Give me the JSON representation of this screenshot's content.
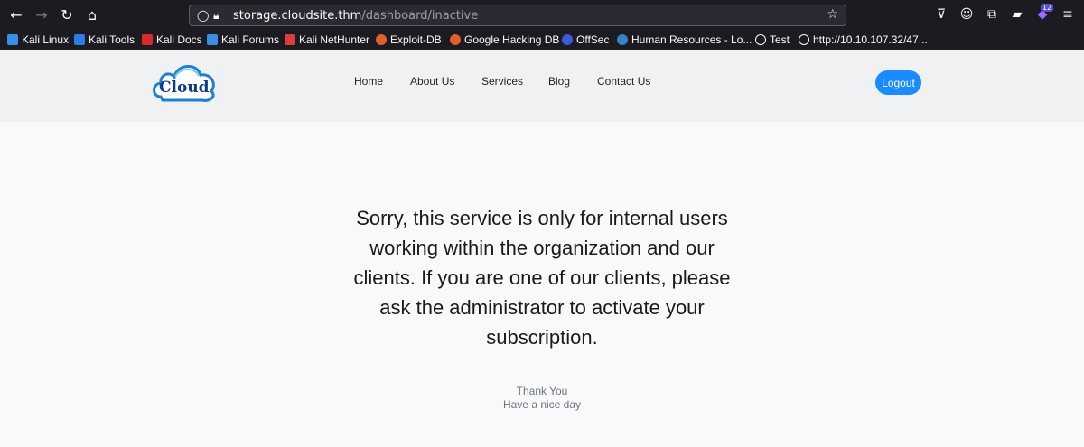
{
  "browser": {
    "url_host": "storage.cloudsite.thm",
    "url_path": "/dashboard/inactive",
    "extension_badge": "12"
  },
  "bookmarks": [
    {
      "label": "Kali Linux",
      "icon": "kali-dragon-icon"
    },
    {
      "label": "Kali Tools",
      "icon": "kali-tools-icon"
    },
    {
      "label": "Kali Docs",
      "icon": "kali-docs-icon"
    },
    {
      "label": "Kali Forums",
      "icon": "kali-forums-icon"
    },
    {
      "label": "Kali NetHunter",
      "icon": "nethunter-icon"
    },
    {
      "label": "Exploit-DB",
      "icon": "exploit-db-icon"
    },
    {
      "label": "Google Hacking DB",
      "icon": "ghdb-icon"
    },
    {
      "label": "OffSec",
      "icon": "offsec-icon"
    },
    {
      "label": "Human Resources - Lo...",
      "icon": "wordpress-icon"
    },
    {
      "label": "Test",
      "icon": "globe-icon"
    },
    {
      "label": "http://10.10.107.32/47...",
      "icon": "globe-icon"
    }
  ],
  "site": {
    "logo_text": "Cloud",
    "nav": [
      "Home",
      "About Us",
      "Services",
      "Blog",
      "Contact Us"
    ],
    "logout_label": "Logout",
    "accent_color": "#1a8cff"
  },
  "main": {
    "message": "Sorry, this service is only for internal users working within the organization and our clients. If you are one of our clients, please ask the administrator to activate your subscription.",
    "thanks_line1": "Thank You",
    "thanks_line2": "Have a nice day"
  }
}
